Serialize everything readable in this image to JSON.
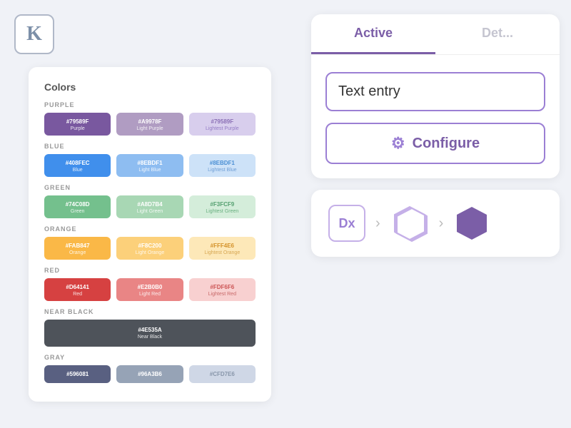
{
  "logo": {
    "letter": "K"
  },
  "color_card": {
    "title": "Colors",
    "sections": [
      {
        "label": "PURPLE",
        "swatches": [
          {
            "hex": "#79589F",
            "name": "Purple",
            "bg": "#79589F",
            "dark": false
          },
          {
            "hex": "#A9978F",
            "name": "Light Purple",
            "bg": "#b09cc2",
            "dark": false
          },
          {
            "hex": "#79589F",
            "name": "Lightest Purple",
            "bg": "#d8ceed",
            "dark": false
          }
        ]
      },
      {
        "label": "BLUE",
        "swatches": [
          {
            "hex": "#408FEC",
            "name": "Blue",
            "bg": "#408FEC",
            "dark": false
          },
          {
            "hex": "#8EBDF1",
            "name": "Light Blue",
            "bg": "#8EBDF1",
            "dark": false
          },
          {
            "hex": "#8EBDF1",
            "name": "Lightest Blue",
            "bg": "#cde2f8",
            "dark": false
          }
        ]
      },
      {
        "label": "GREEN",
        "swatches": [
          {
            "hex": "#74C08D",
            "name": "Green",
            "bg": "#74C08D",
            "dark": false
          },
          {
            "hex": "#A8D7B4",
            "name": "Light Green",
            "bg": "#A8D7B4",
            "dark": false
          },
          {
            "hex": "#F3FCF9",
            "name": "Lightest Green",
            "bg": "#d4edda",
            "dark": false
          }
        ]
      },
      {
        "label": "ORANGE",
        "swatches": [
          {
            "hex": "#FAB847",
            "name": "Orange",
            "bg": "#FAB847",
            "dark": false
          },
          {
            "hex": "#F8C200",
            "name": "Light Orange",
            "bg": "#fcd07a",
            "dark": false
          },
          {
            "hex": "#FFF4E6",
            "name": "Lightest Orange",
            "bg": "#fde8b8",
            "dark": false
          }
        ]
      },
      {
        "label": "RED",
        "swatches": [
          {
            "hex": "#D64141",
            "name": "Red",
            "bg": "#D64141",
            "dark": false
          },
          {
            "hex": "#E2B0B0",
            "name": "Light Red",
            "bg": "#e98585",
            "dark": false
          },
          {
            "hex": "#FDF6F6",
            "name": "Lightest Red",
            "bg": "#f8d0d0",
            "dark": false
          }
        ]
      },
      {
        "label": "NEAR BLACK",
        "swatches": [
          {
            "hex": "#4E535A",
            "name": "Near Black",
            "bg": "#4E535A",
            "dark": false,
            "full": true
          }
        ]
      },
      {
        "label": "GRAY",
        "swatches": [
          {
            "hex": "#596081",
            "name": "",
            "bg": "#596081",
            "dark": false
          },
          {
            "hex": "#96A3B6",
            "name": "",
            "bg": "#96A3B6",
            "dark": false
          },
          {
            "hex": "#CFD7E6",
            "name": "",
            "bg": "#CFD7E6",
            "dark": false
          }
        ]
      }
    ]
  },
  "tabs": {
    "items": [
      {
        "label": "Active",
        "active": true
      },
      {
        "label": "Det...",
        "active": false
      }
    ]
  },
  "text_input": {
    "value": "Text entry",
    "placeholder": "Text entry"
  },
  "configure_button": {
    "label": "Configure",
    "icon": "⚙"
  },
  "pipeline": {
    "steps": [
      {
        "type": "dx",
        "label": "Dx"
      },
      {
        "type": "hex-stack",
        "label": ""
      },
      {
        "type": "hex-solid",
        "label": ""
      }
    ],
    "arrows": [
      ">",
      ">"
    ]
  }
}
